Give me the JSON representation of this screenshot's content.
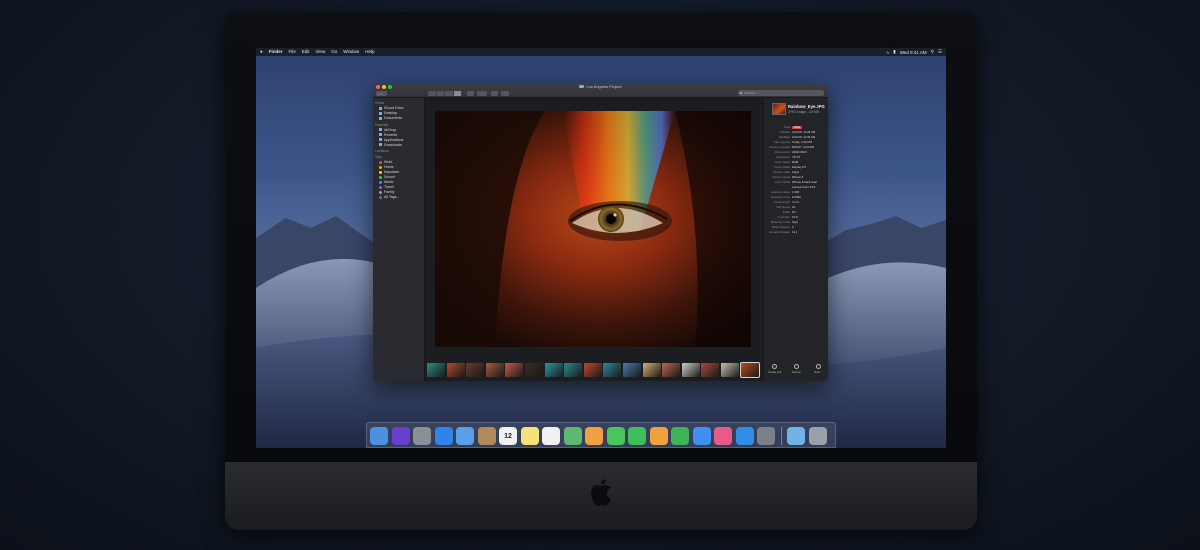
{
  "menubar": {
    "app": "Finder",
    "items": [
      "File",
      "Edit",
      "View",
      "Go",
      "Window",
      "Help"
    ],
    "clock": "Wed 9:41 AM"
  },
  "window": {
    "title": "Los Angeles Project",
    "search_placeholder": "Search"
  },
  "sidebar": {
    "favorites_header": "iCloud",
    "icloud": [
      "iCloud Drive",
      "Desktop",
      "Documents"
    ],
    "places_header": "Favorites",
    "favorites": [
      "AirDrop",
      "Recents",
      "Applications",
      "Downloads"
    ],
    "locations_header": "Locations",
    "tags_header": "Tags",
    "tags": [
      {
        "label": "Work",
        "color": "#e0474c"
      },
      {
        "label": "Home",
        "color": "#f0a030"
      },
      {
        "label": "Important",
        "color": "#f4d03f"
      },
      {
        "label": "School",
        "color": "#3fbf5a"
      },
      {
        "label": "Music",
        "color": "#3f8ef0"
      },
      {
        "label": "Travel",
        "color": "#a855d8"
      },
      {
        "label": "Family",
        "color": "#9a9aa0"
      },
      {
        "label": "All Tags...",
        "color": "#6e6e74"
      }
    ]
  },
  "inspector": {
    "filename": "Rainbow_Eye.JPG",
    "subtitle": "JPEG image - 2.8 MB",
    "tag": "Work",
    "metadata": [
      {
        "k": "Tags",
        "v": ""
      },
      {
        "k": "Created",
        "v": "2/13/18, 11:36 AM"
      },
      {
        "k": "Modified",
        "v": "2/13/18, 11:36 AM"
      },
      {
        "k": "Last opened",
        "v": "Today, 2:20 PM"
      },
      {
        "k": "Content created",
        "v": "8/23/17, 4:03 PM"
      },
      {
        "k": "Dimensions",
        "v": "4032×3024"
      },
      {
        "k": "Resolution",
        "v": "72×72"
      },
      {
        "k": "Color space",
        "v": "RGB"
      },
      {
        "k": "Color profile",
        "v": "Display P3"
      },
      {
        "k": "Device make",
        "v": "Apple"
      },
      {
        "k": "Device model",
        "v": "iPhone 8"
      },
      {
        "k": "Lens model",
        "v": "iPhone 8 back dual"
      },
      {
        "k": "",
        "v": "camera 4mm f/1.8"
      },
      {
        "k": "Aperture value",
        "v": "1.696"
      },
      {
        "k": "Exposure time",
        "v": "1/2392"
      },
      {
        "k": "Focal length",
        "v": "4 mm"
      },
      {
        "k": "ISO speed",
        "v": "20"
      },
      {
        "k": "Flash",
        "v": "No"
      },
      {
        "k": "F number",
        "v": "f/1.8"
      },
      {
        "k": "Metering mode",
        "v": "Spot"
      },
      {
        "k": "White balance",
        "v": "0"
      },
      {
        "k": "Content Creator",
        "v": "11.2"
      }
    ],
    "actions": [
      "Rotate Left",
      "Markup",
      "More..."
    ]
  },
  "colors": {
    "accent": "#3f8ef0",
    "window_bg": "#1f2024"
  },
  "dock": {
    "apps": [
      {
        "icon": "finder-icon",
        "color": "#4d8fe0"
      },
      {
        "icon": "siri-icon",
        "color": "#6a3fd0"
      },
      {
        "icon": "launchpad-icon",
        "color": "#8a8f99"
      },
      {
        "icon": "safari-icon",
        "color": "#2f84e8"
      },
      {
        "icon": "mail-icon",
        "color": "#5aa0e8"
      },
      {
        "icon": "contacts-icon",
        "color": "#b08a5a"
      },
      {
        "icon": "calendar-icon",
        "color": "#f2f2f2"
      },
      {
        "icon": "notes-icon",
        "color": "#f6e27a"
      },
      {
        "icon": "reminders-icon",
        "color": "#f0f0f0"
      },
      {
        "icon": "maps-icon",
        "color": "#5fb870"
      },
      {
        "icon": "photos-icon",
        "color": "#f0a040"
      },
      {
        "icon": "messages-icon",
        "color": "#4bc65d"
      },
      {
        "icon": "facetime-icon",
        "color": "#3fbf5a"
      },
      {
        "icon": "pages-icon",
        "color": "#f0a040"
      },
      {
        "icon": "numbers-icon",
        "color": "#3fb35a"
      },
      {
        "icon": "keynote-icon",
        "color": "#3f8ef0"
      },
      {
        "icon": "itunes-icon",
        "color": "#e85a8a"
      },
      {
        "icon": "app-store-icon",
        "color": "#2f8ee8"
      },
      {
        "icon": "system-preferences-icon",
        "color": "#7d8088"
      },
      {
        "icon": "downloads-folder-icon",
        "color": "#6fb3e8"
      },
      {
        "icon": "trash-icon",
        "color": "#9aa0aa"
      }
    ],
    "calendar_day": "12"
  }
}
